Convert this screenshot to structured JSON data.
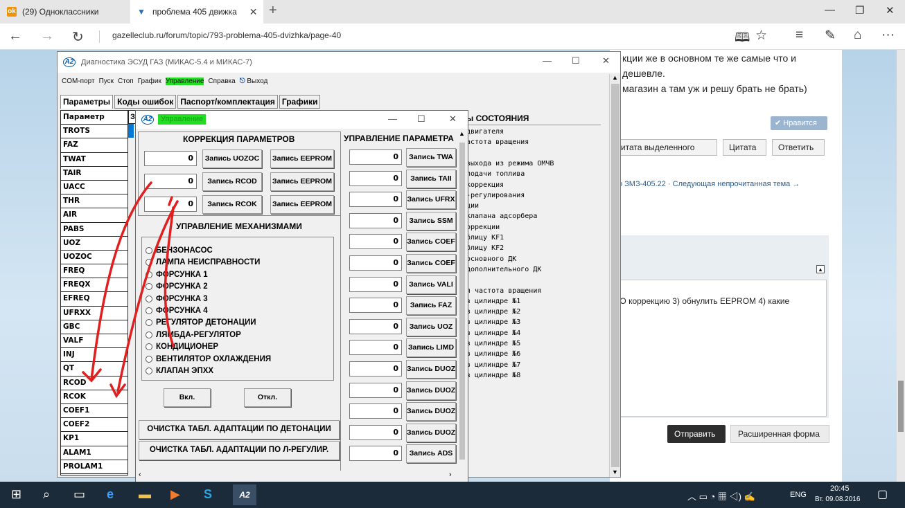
{
  "browser": {
    "tabs": [
      {
        "label": "(29) Одноклассники",
        "icon": "odnoklassniki-icon",
        "active": false
      },
      {
        "label": "проблема 405 движка",
        "icon": "gazelleclub-icon",
        "active": true
      }
    ],
    "url": "gazelleclub.ru/forum/topic/793-problema-405-dvizhka/page-40"
  },
  "forum": {
    "lines": [
      "кции же в основном те же самые что и",
      "дешевле.",
      "магазин а там уж и решу брать не брать)"
    ],
    "like_label": "✔ Нравится",
    "quote_selected_label": "цитата выделенного",
    "quote_label": "Цитата",
    "reply_label": "Ответить",
    "next_links": "по ЗМЗ-405.22 · Следующая непрочитанная тема →",
    "reply_text": "СО коррекцию 3) обнулить EEPROM 4) какие",
    "send_label": "Отправить",
    "extended_label": "Расширенная форма"
  },
  "app": {
    "title": "Диагностика ЭСУД ГАЗ (МИКАС-5.4 и МИКАС-7)",
    "menu": [
      "COM-порт",
      "Пуск",
      "Стоп",
      "График",
      "Управление",
      "Справка",
      "Выход"
    ],
    "tabs": [
      "Параметры",
      "Коды ошибок",
      "Паспорт/комплектация",
      "Графики"
    ],
    "param_header": "Параметр",
    "col2_header": "З",
    "params": [
      "TROTS",
      "FAZ",
      "TWAT",
      "TAIR",
      "UACC",
      "THR",
      "AIR",
      "PABS",
      "UOZ",
      "UOZOC",
      "FREQ",
      "FREQX",
      "EFREQ",
      "UFRXX",
      "GBC",
      "VALF",
      "INJ",
      "QT",
      "RCOD",
      "RCOK",
      "COEF1",
      "COEF2",
      "KP1",
      "ALAM1",
      "PROLAM1"
    ],
    "state_header": "ы СОСТОЯНИЯ",
    "state_rows": [
      "двигателя",
      "астота вращения",
      "",
      "выхода из режима ОМЧВ",
      "подачи топлива",
      "коррекция",
      "-регулирования",
      "ции",
      "клапана адсорбера",
      "оррекции",
      "блицу KF1",
      "блицу KF2",
      "основного ДК",
      "дополнительного ДК",
      "",
      "я частота вращения",
      "в цилиндре №1",
      "в цилиндре №2",
      "в цилиндре №3",
      "в цилиндре №4",
      "в цилиндре №5",
      "в цилиндре №6",
      "в цилиндре №7",
      "в цилиндре №8"
    ]
  },
  "dialog": {
    "title": "Управление",
    "correction_title": "КОРРЕКЦИЯ ПАРАМЕТРОВ",
    "corrections": [
      {
        "value": "0",
        "write": "Запись UOZOC",
        "eeprom": "Запись EEPROM"
      },
      {
        "value": "0",
        "write": "Запись RCOD",
        "eeprom": "Запись EEPROM"
      },
      {
        "value": "0",
        "write": "Запись RCOK",
        "eeprom": "Запись EEPROM"
      }
    ],
    "mech_title": "УПРАВЛЕНИЕ МЕХАНИЗМАМИ",
    "mechanisms": [
      "БЕНЗОНАСОС",
      "ЛАМПА НЕИСПРАВНОСТИ",
      "ФОРСУНКА 1",
      "ФОРСУНКА 2",
      "ФОРСУНКА 3",
      "ФОРСУНКА 4",
      "РЕГУЛЯТОР ДЕТОНАЦИИ",
      "ЛЯМБДА-РЕГУЛЯТОР",
      "КОНДИЦИОНЕР",
      "ВЕНТИЛЯТОР ОХЛАЖДЕНИЯ",
      "КЛАПАН ЭПХХ"
    ],
    "on_label": "Вкл.",
    "off_label": "Откл.",
    "clear_knock": "ОЧИСТКА ТАБЛ. АДАПТАЦИИ ПО ДЕТОНАЦИИ",
    "clear_lambda": "ОЧИСТКА ТАБЛ. АДАПТАЦИИ ПО Л-РЕГУЛИР.",
    "param_ctrl_title": "УПРАВЛЕНИЕ ПАРАМЕТРА",
    "param_ctrl": [
      {
        "value": "0",
        "label": "Запись TWA"
      },
      {
        "value": "0",
        "label": "Запись TAII"
      },
      {
        "value": "0",
        "label": "Запись UFRX"
      },
      {
        "value": "0",
        "label": "Запись SSM"
      },
      {
        "value": "0",
        "label": "Запись COEF"
      },
      {
        "value": "0",
        "label": "Запись COEF"
      },
      {
        "value": "0",
        "label": "Запись VALI"
      },
      {
        "value": "0",
        "label": "Запись FAZ"
      },
      {
        "value": "0",
        "label": "Запись UOZ"
      },
      {
        "value": "0",
        "label": "Запись LIMD"
      },
      {
        "value": "0",
        "label": "Запись DUOZ"
      },
      {
        "value": "0",
        "label": "Запись DUOZ"
      },
      {
        "value": "0",
        "label": "Запись DUOZ"
      },
      {
        "value": "0",
        "label": "Запись DUOZ"
      },
      {
        "value": "0",
        "label": "Запись ADS"
      }
    ]
  },
  "taskbar": {
    "lang": "ENG",
    "time": "20:45",
    "date": "Вт. 09.08.2016"
  }
}
